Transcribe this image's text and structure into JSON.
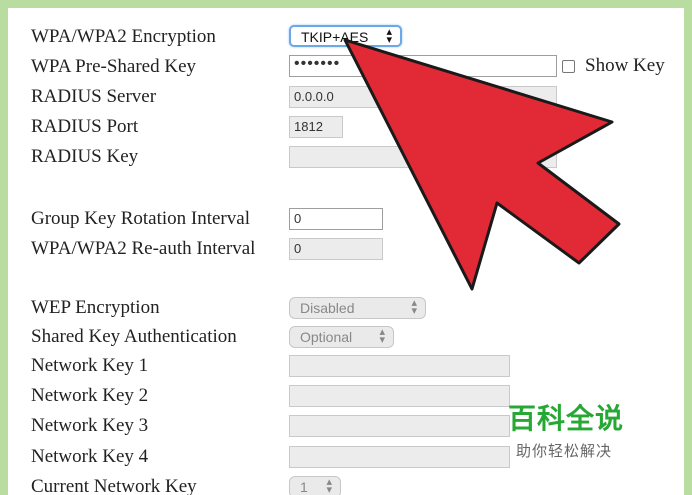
{
  "labels": {
    "wpa_encryption": "WPA/WPA2 Encryption",
    "wpa_psk": "WPA Pre-Shared Key",
    "radius_server": "RADIUS Server",
    "radius_port": "RADIUS Port",
    "radius_key": "RADIUS Key",
    "group_key_rotation": "Group Key Rotation Interval",
    "reauth_interval": "WPA/WPA2 Re-auth Interval",
    "wep_encryption": "WEP Encryption",
    "shared_key_auth": "Shared Key Authentication",
    "network_key_1": "Network Key 1",
    "network_key_2": "Network Key 2",
    "network_key_3": "Network Key 3",
    "network_key_4": "Network Key 4",
    "current_network_key": "Current Network Key",
    "show_key": "Show Key"
  },
  "values": {
    "wpa_encryption": "TKIP+AES",
    "wpa_psk": "•••••••",
    "radius_server": "0.0.0.0",
    "radius_port": "1812",
    "radius_key": "",
    "group_key_rotation": "0",
    "reauth_interval": "0",
    "wep_encryption": "Disabled",
    "shared_key_auth": "Optional",
    "network_key_1": "",
    "network_key_2": "",
    "network_key_3": "",
    "network_key_4": "",
    "current_network_key": "1",
    "show_key_checked": false
  },
  "watermark": {
    "title": "百科全说",
    "subtitle": "助你轻松解决"
  },
  "colors": {
    "arrow": "#e12a35",
    "watermark_green": "#27a835",
    "frame": "#b9dca0"
  }
}
